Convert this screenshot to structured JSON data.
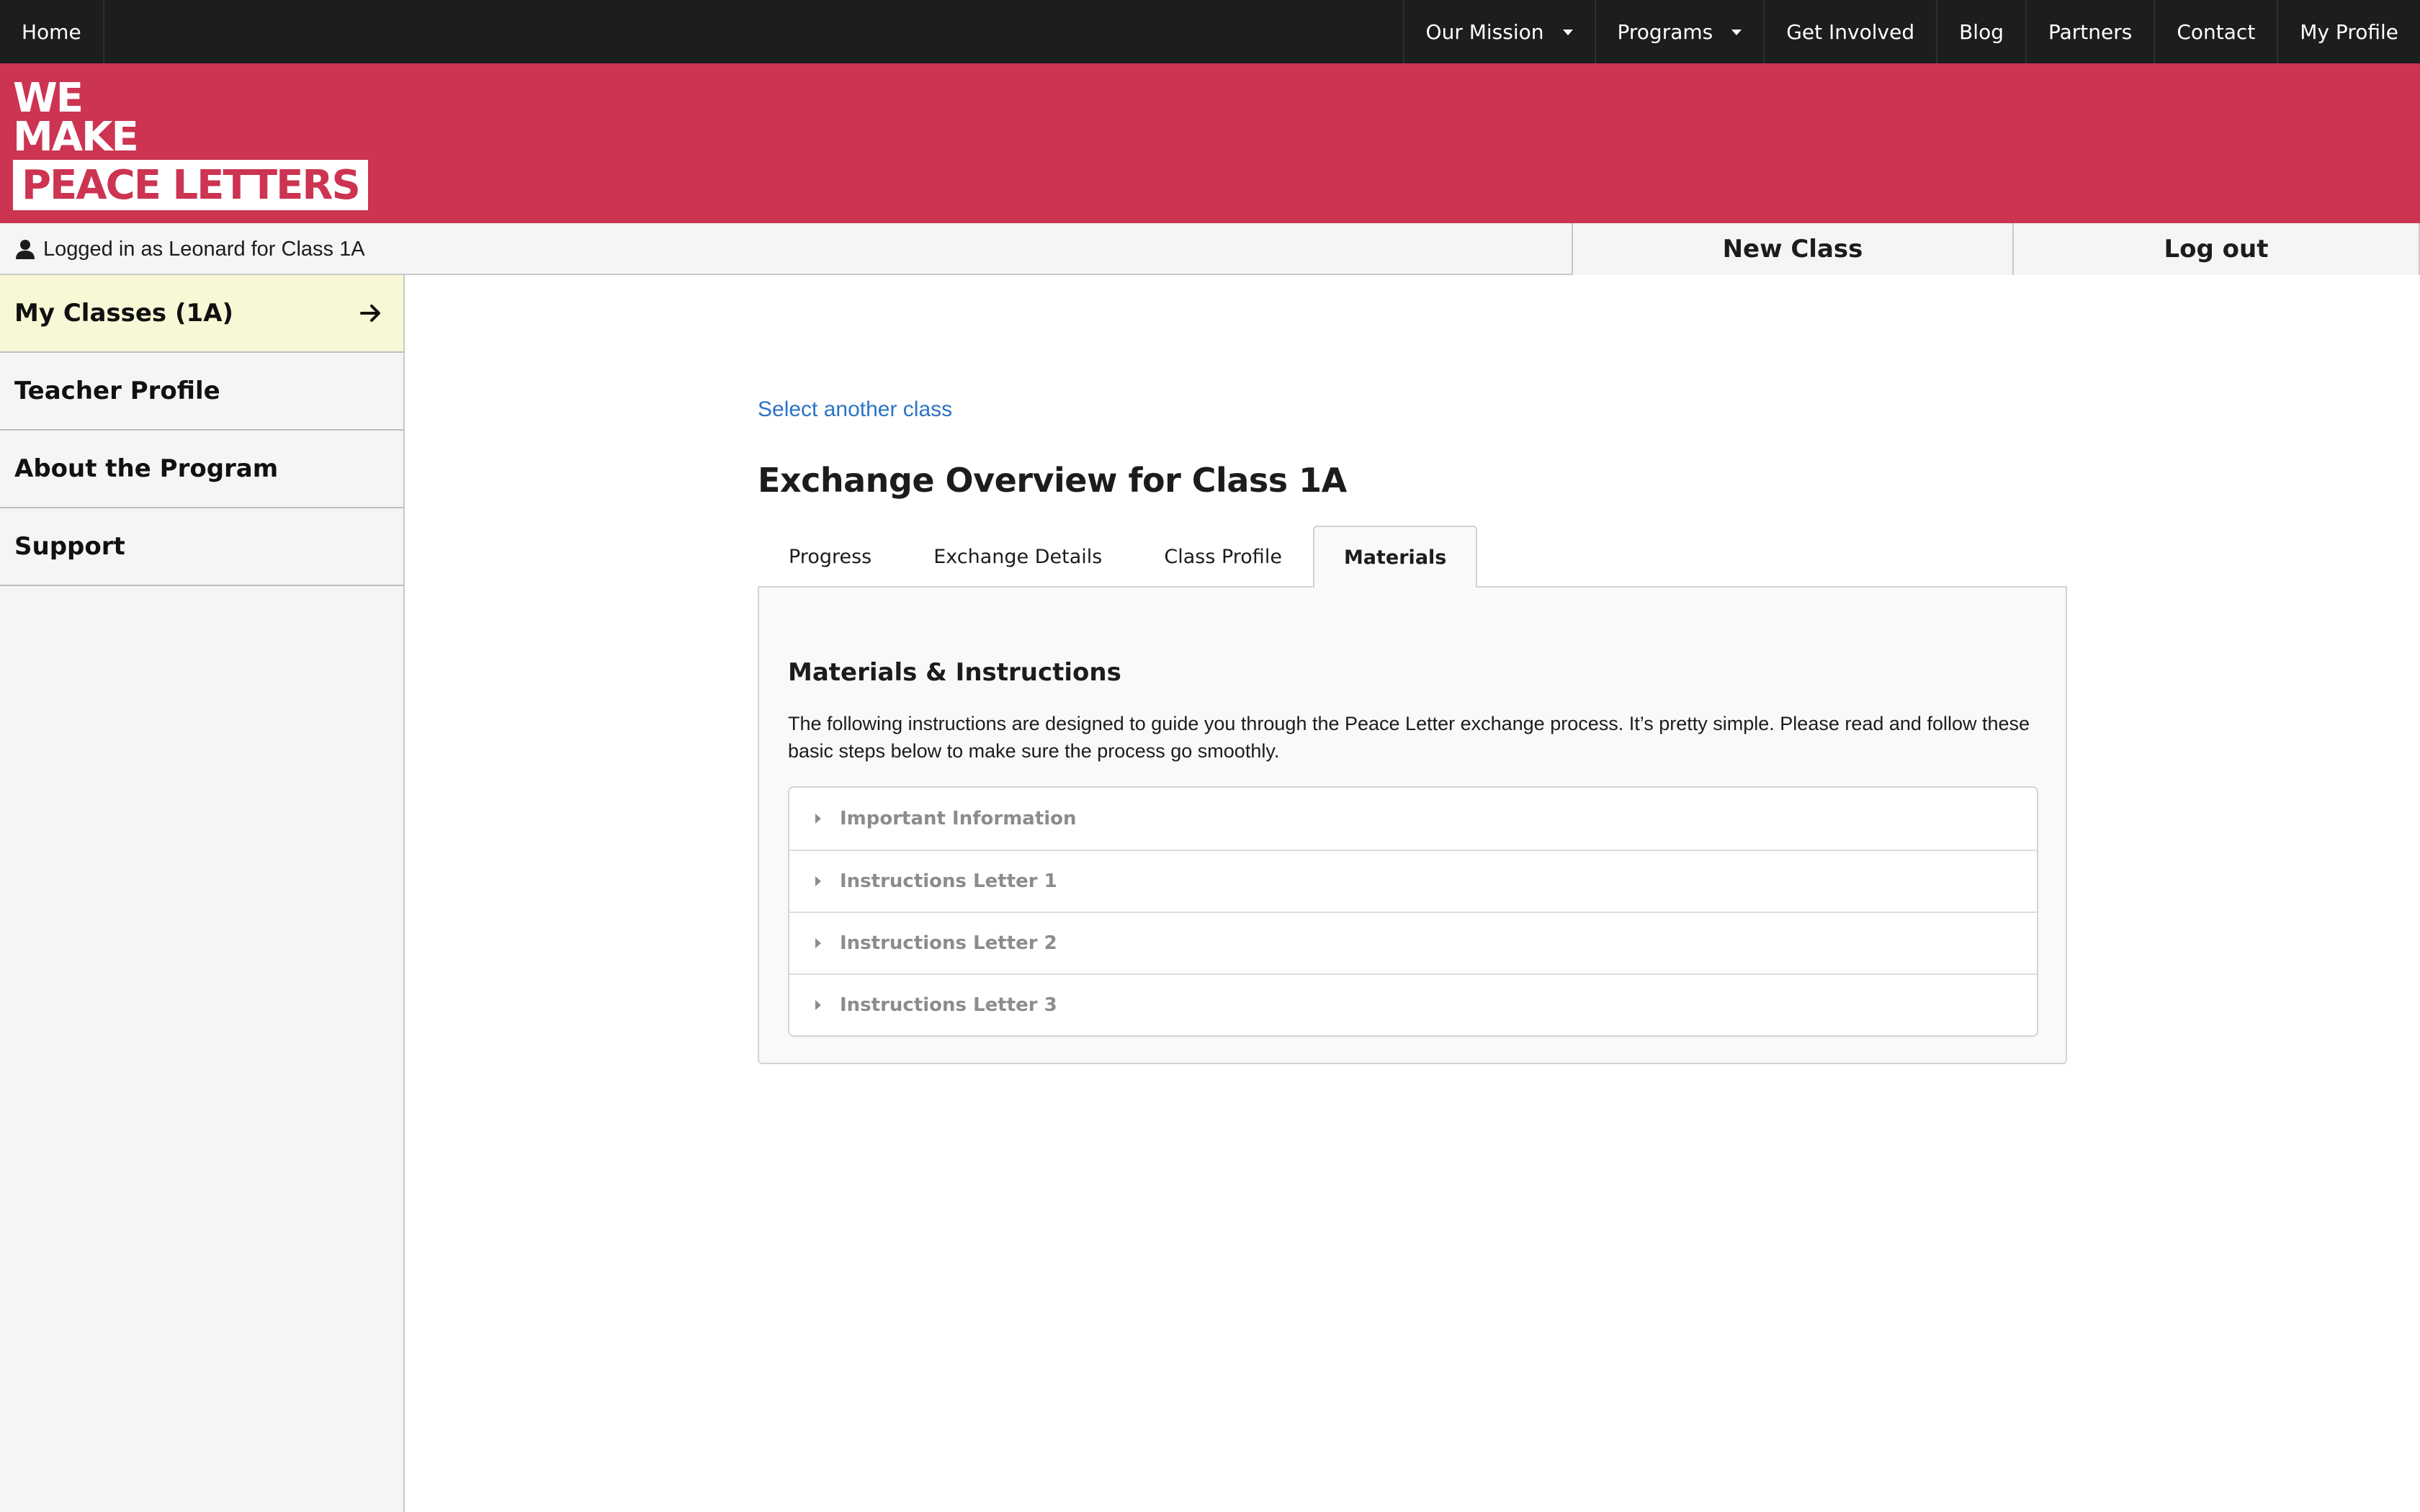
{
  "topnav": {
    "left": [
      {
        "label": "Home"
      }
    ],
    "right": [
      {
        "label": "Our Mission"
      },
      {
        "label": "Programs"
      },
      {
        "label": "Get Involved"
      },
      {
        "label": "Blog"
      },
      {
        "label": "Partners"
      },
      {
        "label": "Contact"
      },
      {
        "label": "My Profile"
      }
    ]
  },
  "brand": {
    "line1": "WE",
    "line2": "MAKE",
    "line3": "PEACE LETTERS",
    "color": "#cc3451"
  },
  "account": {
    "user_icon": "user-icon",
    "logged_in_text": "Logged in as Leonard for Class 1A",
    "new_class_label": "New Class",
    "logout_label": "Log out"
  },
  "sidebar": {
    "items": [
      {
        "label": "My Classes (1A)",
        "icon": "arrow-right-icon",
        "active": true
      },
      {
        "label": "Teacher Profile"
      },
      {
        "label": "About the Program"
      },
      {
        "label": "Support"
      }
    ],
    "active_color": "#f8f8d7"
  },
  "main": {
    "select_link": "Select another class",
    "link_color": "#2c73c5",
    "title": "Exchange Overview for Class 1A",
    "tabs": [
      {
        "label": "Progress"
      },
      {
        "label": "Exchange Details"
      },
      {
        "label": "Class Profile"
      },
      {
        "label": "Materials",
        "active": true
      }
    ],
    "panel": {
      "heading": "Materials & Instructions",
      "text": "The following instructions are designed to guide you through the Peace Letter exchange process. It’s pretty simple. Please read and follow these basic steps below to make sure the process go smoothly.",
      "accordion": [
        {
          "label": "Important Information"
        },
        {
          "label": "Instructions Letter 1"
        },
        {
          "label": "Instructions Letter 2"
        },
        {
          "label": "Instructions Letter 3"
        }
      ]
    }
  }
}
